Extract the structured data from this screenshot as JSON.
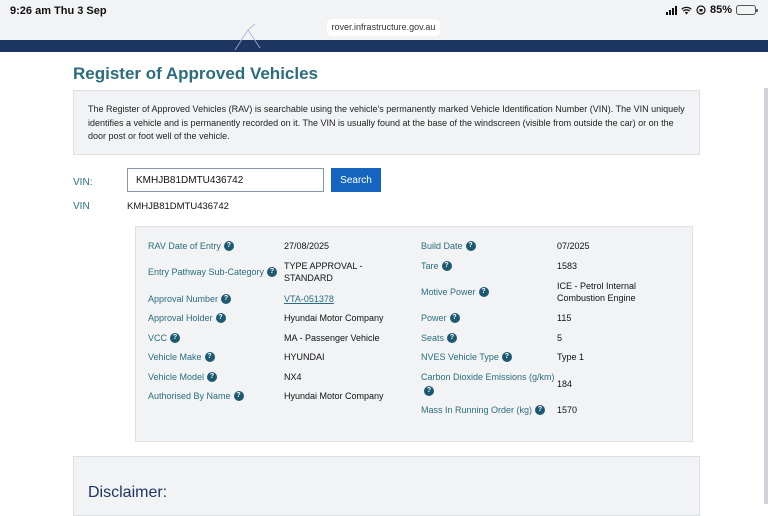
{
  "status_bar": {
    "time": "9:26 am",
    "date": "Thu 3 Sep",
    "battery_percent": "85%",
    "battery_level": 0.85
  },
  "browser": {
    "url": "rover.infrastructure.gov.au"
  },
  "page": {
    "title": "Register of Approved Vehicles",
    "intro": "The Register of Approved Vehicles (RAV) is searchable using the vehicle's permanently marked Vehicle Identification Number (VIN). The VIN uniquely identifies a vehicle and is permanently recorded on it. The VIN is usually found at the base of the windscreen (visible from outside the car) or on the door post or foot well of the vehicle."
  },
  "search": {
    "label": "VIN:",
    "value": "KMHJB81DMTU436742",
    "button": "Search"
  },
  "result": {
    "vin_label": "VIN",
    "vin_value": "KMHJB81DMTU436742"
  },
  "details": {
    "left": [
      {
        "label": "RAV Date of Entry",
        "value": "27/08/2025"
      },
      {
        "label": "Entry Pathway Sub-Category",
        "value": "TYPE APPROVAL - STANDARD"
      },
      {
        "label": "Approval Number",
        "value": "VTA-051378"
      },
      {
        "label": "Approval Holder",
        "value": "Hyundai Motor Company"
      },
      {
        "label": "VCC",
        "value": "MA - Passenger Vehicle"
      },
      {
        "label": "Vehicle Make",
        "value": "HYUNDAI"
      },
      {
        "label": "Vehicle Model",
        "value": "NX4"
      },
      {
        "label": "Authorised By Name",
        "value": "Hyundai Motor Company"
      }
    ],
    "right": [
      {
        "label": "Build Date",
        "value": "07/2025"
      },
      {
        "label": "Tare",
        "value": "1583"
      },
      {
        "label": "Motive Power",
        "value": "ICE - Petrol Internal Combustion Engine"
      },
      {
        "label": "Power",
        "value": "115"
      },
      {
        "label": "Seats",
        "value": "5"
      },
      {
        "label": "NVES Vehicle Type",
        "value": "Type 1"
      },
      {
        "label": "Carbon Dioxide Emissions (g/km)",
        "value": "184"
      },
      {
        "label": "Mass In Running Order (kg)",
        "value": "1570"
      }
    ]
  },
  "disclaimer": {
    "title": "Disclaimer:"
  },
  "icons": {
    "help": "question-circle-icon",
    "wifi": "wifi-icon",
    "signal": "cellular-signal-icon",
    "battery": "battery-icon"
  },
  "colors": {
    "accent": "#2b6d7e",
    "button": "#1565c0",
    "nav": "#1d3563"
  }
}
